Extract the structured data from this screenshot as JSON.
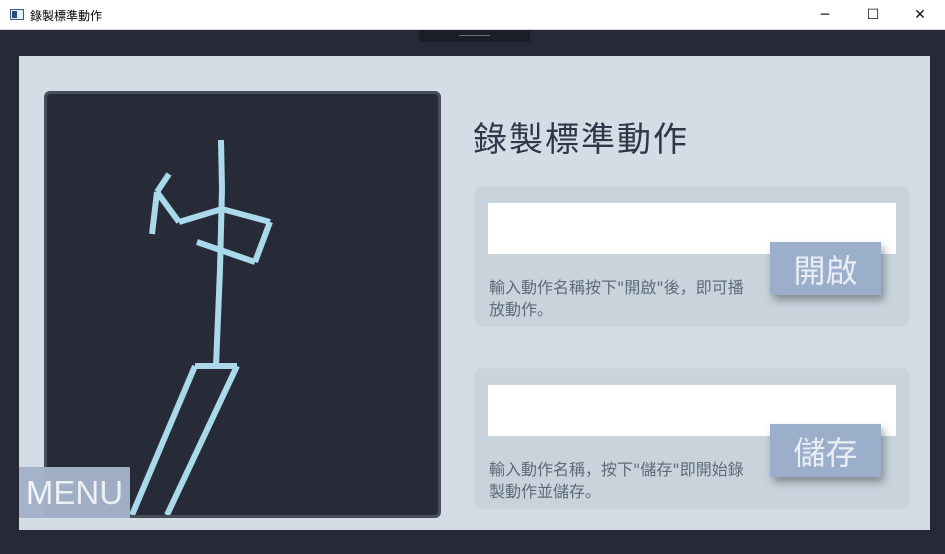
{
  "window": {
    "title": "錄製標準動作",
    "minimize_glyph": "─",
    "maximize_glyph": "☐",
    "close_glyph": "✕"
  },
  "icons": {
    "app": "app-window-icon",
    "minimize": "minimize-icon",
    "maximize": "maximize-icon",
    "close": "close-icon"
  },
  "main": {
    "heading": "錄製標準動作",
    "open_section": {
      "input_value": "",
      "hint": "輸入動作名稱按下\"開啟\"後，即可播放動作。",
      "button_label": "開啟"
    },
    "save_section": {
      "input_value": "",
      "hint": "輸入動作名稱，按下\"儲存\"即開始錄製動作並儲存。",
      "button_label": "儲存"
    },
    "menu_button_label": "MENU"
  },
  "colors": {
    "background": "#252a36",
    "panel": "#d4dde5",
    "card": "#c8d3dc",
    "button": "#9cafca",
    "skeleton": "#a9d9ea"
  }
}
